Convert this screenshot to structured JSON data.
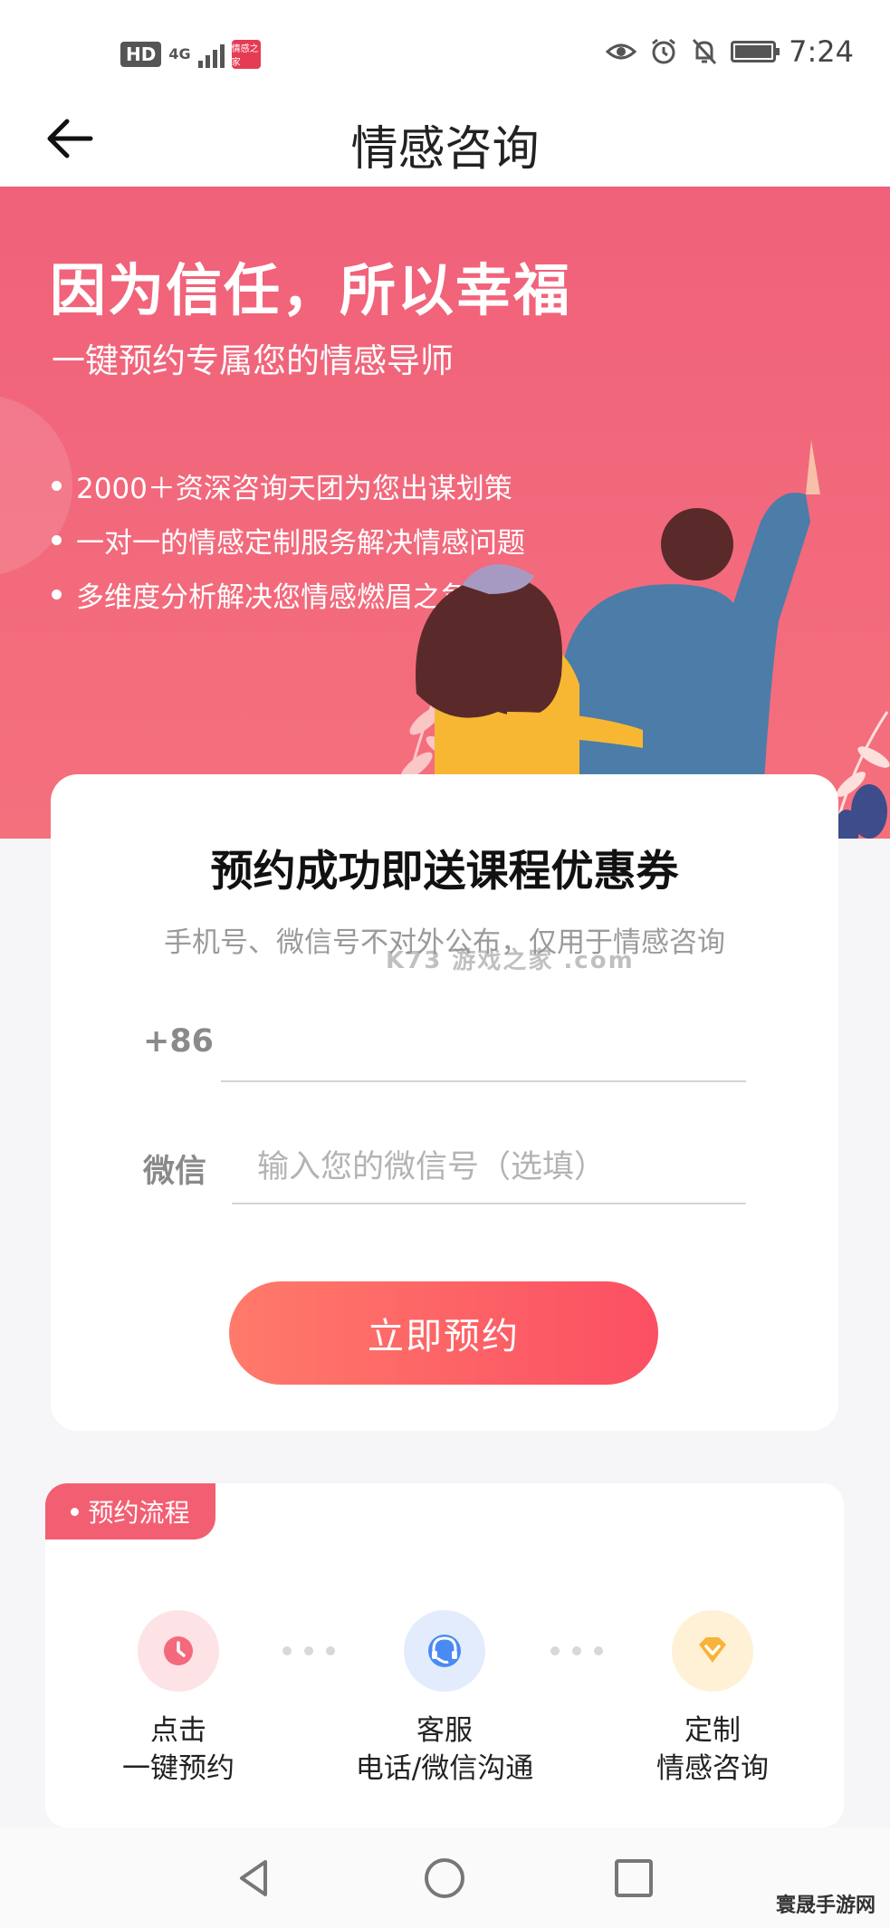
{
  "status_bar": {
    "hd": "HD",
    "network": "4G",
    "app_badge": "情感之家",
    "time": "7:24"
  },
  "nav": {
    "title": "情感咨询"
  },
  "hero": {
    "title": "因为信任，所以幸福",
    "subtitle": "一键预约专属您的情感导师",
    "bullets": [
      "2000＋资深咨询天团为您出谋划策",
      "一对一的情感定制服务解决情感问题",
      "多维度分析解决您情感燃眉之急"
    ]
  },
  "booking_card": {
    "title": "预约成功即送课程优惠券",
    "note": "手机号、微信号不对外公布，仅用于情感咨询",
    "watermark": "K73 游戏之家 .com",
    "phone_prefix": "+86",
    "phone_value": "",
    "wechat_label": "微信",
    "wechat_placeholder": "输入您的微信号（选填）",
    "submit_label": "立即预约"
  },
  "flow": {
    "tag": "预约流程",
    "steps": [
      {
        "line1": "点击",
        "line2": "一键预约",
        "icon": "clock-icon",
        "color": "#fde3e6"
      },
      {
        "line1": "客服",
        "line2": "电话/微信沟通",
        "icon": "headset-icon",
        "color": "#e3ecfd"
      },
      {
        "line1": "定制",
        "line2": "情感咨询",
        "icon": "diamond-icon",
        "color": "#fff1d6"
      }
    ]
  },
  "footer_logo": "寰晟手游网"
}
